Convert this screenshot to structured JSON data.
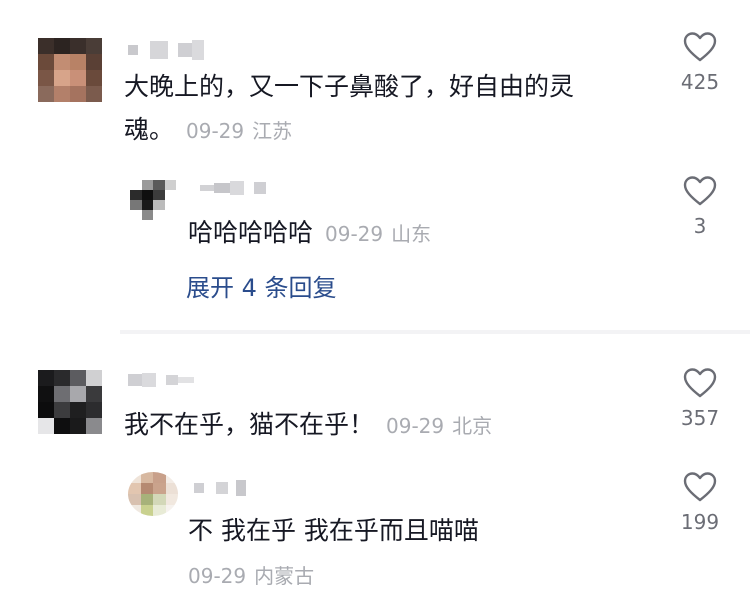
{
  "colors": {
    "text": "#161823",
    "meta": "#a9abb1",
    "link": "#2a4c8c",
    "count": "#6b6d75"
  },
  "comments": [
    {
      "text_line1": "大晚上的，又一下子鼻酸了，好自由的灵",
      "text_line2": "魂。",
      "date": "09-29",
      "location": "江苏",
      "likes": "425",
      "reply": {
        "text": "哈哈哈哈哈",
        "date": "09-29",
        "location": "山东",
        "likes": "3"
      },
      "expand_label": "展开 4 条回复"
    },
    {
      "text": "我不在乎，猫不在乎！",
      "date": "09-29",
      "location": "北京",
      "likes": "357",
      "reply": {
        "text": "不 我在乎 我在乎而且喵喵",
        "date": "09-29",
        "location": "内蒙古",
        "likes": "199"
      }
    }
  ],
  "icons": {
    "like": "heart-outline-icon"
  }
}
